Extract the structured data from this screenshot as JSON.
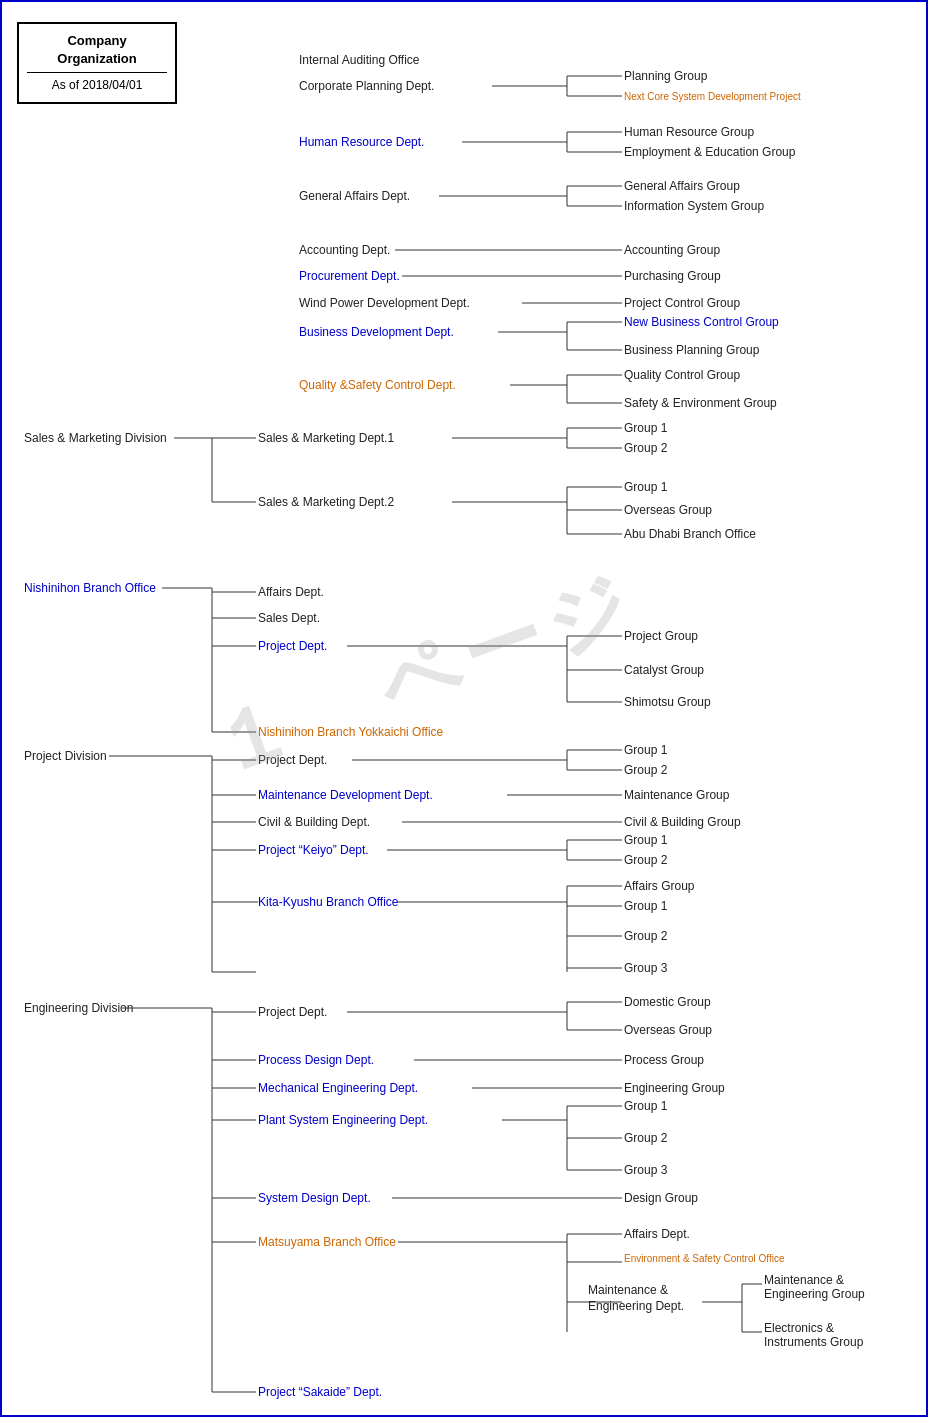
{
  "header": {
    "title": "Company\nOrganization",
    "date": "As of 2018/04/01"
  },
  "watermark": "1 ページ",
  "colors": {
    "blue": "#0000cc",
    "orange": "#cc6600",
    "black": "#222"
  },
  "sections": [
    {
      "division": "",
      "division_color": "black",
      "depts": [
        {
          "name": "Internal Auditing Office",
          "color": "black",
          "groups": []
        },
        {
          "name": "Corporate Planning Dept.",
          "color": "black",
          "groups": [
            {
              "name": "Planning Group",
              "color": "black"
            },
            {
              "name": "Next Core System Development Project",
              "color": "orange",
              "small": true
            }
          ]
        },
        {
          "name": "Human Resource Dept.",
          "color": "blue",
          "groups": [
            {
              "name": "Human Resource Group",
              "color": "black"
            },
            {
              "name": "Employment & Education Group",
              "color": "black"
            }
          ]
        },
        {
          "name": "General Affairs Dept.",
          "color": "black",
          "groups": [
            {
              "name": "General Affairs Group",
              "color": "black"
            },
            {
              "name": "Information System Group",
              "color": "black"
            }
          ]
        },
        {
          "name": "Accounting Dept.",
          "color": "black",
          "groups": [
            {
              "name": "Accounting Group",
              "color": "black"
            }
          ]
        },
        {
          "name": "Procurement Dept.",
          "color": "blue",
          "groups": [
            {
              "name": "Purchasing Group",
              "color": "black"
            }
          ]
        },
        {
          "name": "Wind Power Development Dept.",
          "color": "black",
          "groups": [
            {
              "name": "Project Control Group",
              "color": "black"
            }
          ]
        },
        {
          "name": "Business Development Dept.",
          "color": "blue",
          "groups": [
            {
              "name": "New Business Control Group",
              "color": "blue"
            },
            {
              "name": "Business Planning Group",
              "color": "black"
            }
          ]
        },
        {
          "name": "Quality &Safety Control Dept.",
          "color": "orange",
          "groups": [
            {
              "name": "Quality Control Group",
              "color": "black"
            },
            {
              "name": "Safety & Environment Group",
              "color": "black"
            }
          ]
        }
      ]
    },
    {
      "division": "Sales & Marketing Division",
      "division_color": "black",
      "depts": [
        {
          "name": "Sales & Marketing Dept.1",
          "color": "black",
          "groups": [
            {
              "name": "Group 1",
              "color": "black"
            },
            {
              "name": "Group 2",
              "color": "black"
            }
          ]
        },
        {
          "name": "Sales & Marketing Dept.2",
          "color": "black",
          "groups": [
            {
              "name": "Group 1",
              "color": "black"
            },
            {
              "name": "Overseas Group",
              "color": "black"
            },
            {
              "name": "Abu Dhabi Branch Office",
              "color": "black"
            }
          ]
        }
      ]
    },
    {
      "division": "Nishinihon Branch Office",
      "division_color": "blue",
      "depts": [
        {
          "name": "Affairs Dept.",
          "color": "black",
          "groups": []
        },
        {
          "name": "Sales Dept.",
          "color": "black",
          "groups": []
        },
        {
          "name": "Project Dept.",
          "color": "blue",
          "groups": [
            {
              "name": "Project Group",
              "color": "black"
            },
            {
              "name": "Catalyst Group",
              "color": "black"
            },
            {
              "name": "Shimotsu Group",
              "color": "black"
            }
          ]
        },
        {
          "name": "Nishinihon Branch Yokkaichi Office",
          "color": "orange",
          "groups": []
        }
      ]
    },
    {
      "division": "Project Division",
      "division_color": "black",
      "depts": [
        {
          "name": "Project Dept.",
          "color": "black",
          "groups": [
            {
              "name": "Group 1",
              "color": "black"
            },
            {
              "name": "Group 2",
              "color": "black"
            }
          ]
        },
        {
          "name": "Maintenance Development Dept.",
          "color": "blue",
          "groups": [
            {
              "name": "Maintenance Group",
              "color": "black"
            }
          ]
        },
        {
          "name": "Civil & Building Dept.",
          "color": "black",
          "groups": [
            {
              "name": "Civil & Building Group",
              "color": "black"
            }
          ]
        },
        {
          "name": "Project “Keiyo” Dept.",
          "color": "blue",
          "groups": [
            {
              "name": "Group 1",
              "color": "black"
            },
            {
              "name": "Group 2",
              "color": "black"
            }
          ]
        },
        {
          "name": "Kita-Kyushu Branch Office",
          "color": "blue",
          "groups": [
            {
              "name": "Affairs Group",
              "color": "black"
            },
            {
              "name": "Group 1",
              "color": "black"
            },
            {
              "name": "Group 2",
              "color": "black"
            },
            {
              "name": "Group 3",
              "color": "black"
            }
          ]
        }
      ]
    },
    {
      "division": "Engineering Division",
      "division_color": "black",
      "depts": [
        {
          "name": "Project Dept.",
          "color": "black",
          "groups": [
            {
              "name": "Domestic Group",
              "color": "black"
            },
            {
              "name": "Overseas Group",
              "color": "black"
            }
          ]
        },
        {
          "name": "Process Design Dept.",
          "color": "blue",
          "groups": [
            {
              "name": "Process Group",
              "color": "black"
            }
          ]
        },
        {
          "name": "Mechanical Engineering Dept.",
          "color": "blue",
          "groups": [
            {
              "name": "Engineering Group",
              "color": "black"
            }
          ]
        },
        {
          "name": "Plant System Engineering Dept.",
          "color": "blue",
          "groups": [
            {
              "name": "Group 1",
              "color": "black"
            },
            {
              "name": "Group 2",
              "color": "black"
            },
            {
              "name": "Group 3",
              "color": "black"
            }
          ]
        },
        {
          "name": "System Design Dept.",
          "color": "blue",
          "groups": [
            {
              "name": "Design Group",
              "color": "black"
            }
          ]
        },
        {
          "name": "Matsuyama Branch Office",
          "color": "orange",
          "groups": [
            {
              "name": "Affairs Dept.",
              "color": "black"
            },
            {
              "name": "Environment & Safety Control Office",
              "color": "black",
              "small": true
            },
            {
              "name": "Maintenance & Engineering Dept.",
              "color": "black",
              "sub": [
                {
                  "name": "Maintenance & Engineering Group",
                  "color": "black"
                },
                {
                  "name": "Electronics & Instruments Group",
                  "color": "black"
                }
              ]
            }
          ]
        },
        {
          "name": "Project “Sakaide” Dept.",
          "color": "blue",
          "groups": []
        }
      ]
    }
  ]
}
